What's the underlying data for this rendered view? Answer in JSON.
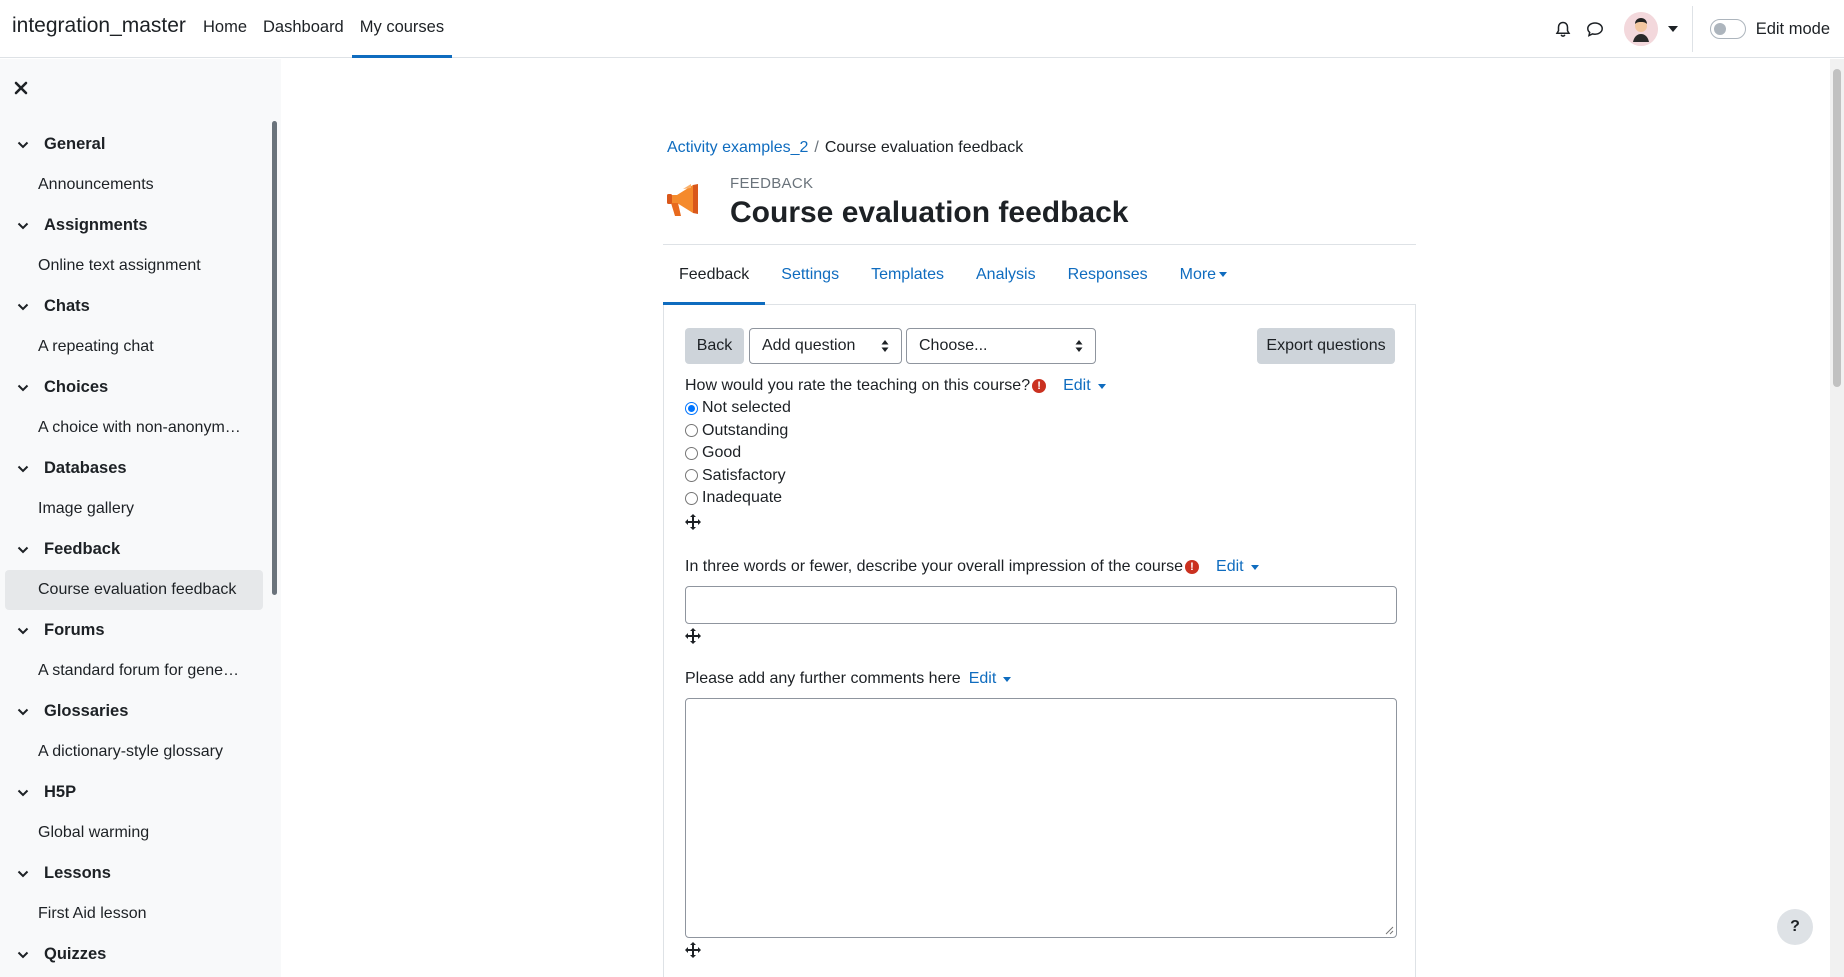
{
  "navbar": {
    "brand": "integration_master",
    "links": [
      "Home",
      "Dashboard",
      "My courses"
    ],
    "active_link": "My courses",
    "edit_mode_label": "Edit mode"
  },
  "drawer": {
    "sections": [
      {
        "title": "General",
        "items": [
          "Announcements"
        ]
      },
      {
        "title": "Assignments",
        "items": [
          "Online text assignment"
        ]
      },
      {
        "title": "Chats",
        "items": [
          "A repeating chat"
        ]
      },
      {
        "title": "Choices",
        "items": [
          "A choice with non-anonym…"
        ]
      },
      {
        "title": "Databases",
        "items": [
          "Image gallery"
        ]
      },
      {
        "title": "Feedback",
        "items": [
          "Course evaluation feedback"
        ]
      },
      {
        "title": "Forums",
        "items": [
          "A standard forum for gene…"
        ]
      },
      {
        "title": "Glossaries",
        "items": [
          "A dictionary-style glossary"
        ]
      },
      {
        "title": "H5P",
        "items": [
          "Global warming"
        ]
      },
      {
        "title": "Lessons",
        "items": [
          "First Aid lesson"
        ]
      },
      {
        "title": "Quizzes",
        "items": []
      }
    ],
    "current_item": "Course evaluation feedback"
  },
  "breadcrumb": {
    "course": "Activity examples_2",
    "current": "Course evaluation feedback"
  },
  "header": {
    "module_label": "FEEDBACK",
    "title": "Course evaluation feedback"
  },
  "tabs": [
    "Feedback",
    "Settings",
    "Templates",
    "Analysis",
    "Responses",
    "More"
  ],
  "active_tab": "Feedback",
  "toolbar": {
    "back_label": "Back",
    "add_question_value": "Add question",
    "template_value": "Choose...",
    "export_label": "Export questions"
  },
  "questions": [
    {
      "label": "How would you rate the teaching on this course?",
      "required": true,
      "edit_label": "Edit",
      "options": [
        "Not selected",
        "Outstanding",
        "Good",
        "Satisfactory",
        "Inadequate"
      ],
      "selected": "Not selected"
    },
    {
      "label": "In three words or fewer, describe your overall impression of the course",
      "required": true,
      "edit_label": "Edit",
      "value": ""
    },
    {
      "label": "Please add any further comments here",
      "required": false,
      "edit_label": "Edit",
      "value": ""
    }
  ],
  "help_label": "?",
  "colors": {
    "link": "#0f6cbf",
    "required": "#ca3120",
    "drawer_bg": "#f8f9fa",
    "button_secondary": "#ced4da"
  }
}
